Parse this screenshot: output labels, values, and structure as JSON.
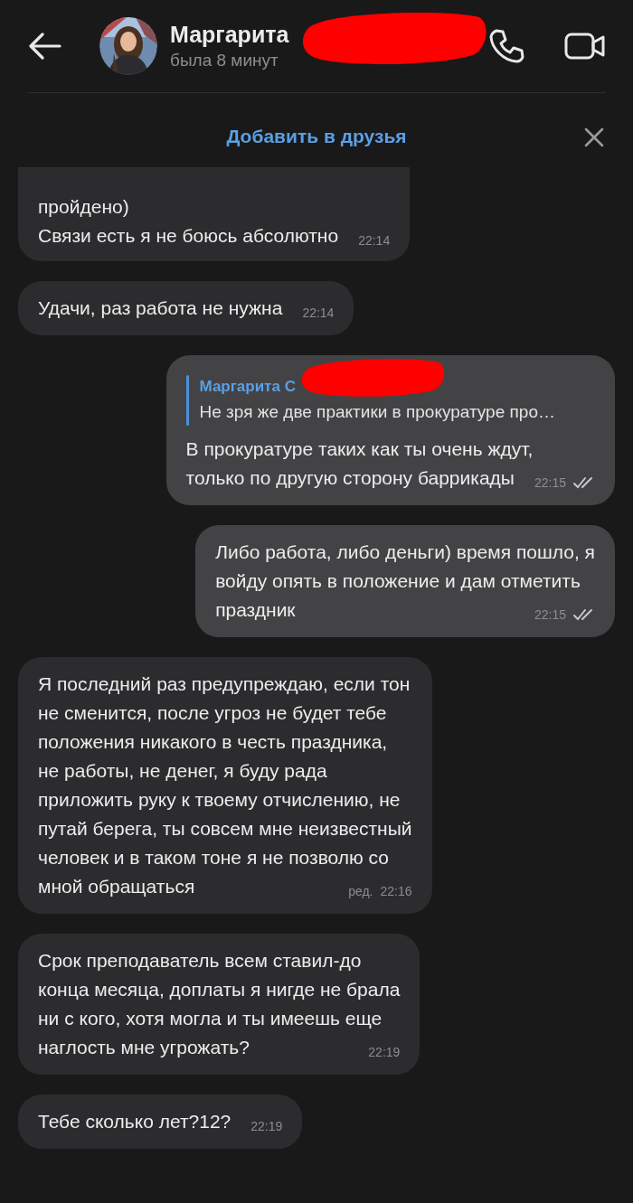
{
  "header": {
    "name": "Маргарита",
    "status": "была 8 минут",
    "redacted": true
  },
  "add_friend": {
    "label": "Добавить в друзья"
  },
  "messages": [
    {
      "kind": "in",
      "clipped": true,
      "text": "пройдено)\nСвязи есть я не боюсь абсолютно",
      "time": "22:14"
    },
    {
      "kind": "in",
      "clipped": false,
      "text": "Удачи, раз работа не нужна",
      "time": "22:14"
    },
    {
      "kind": "out",
      "clipped": false,
      "reply": {
        "name": "Маргарита С",
        "redacted": true,
        "text": "Не зря же две практики в прокуратуре про…"
      },
      "text": "В прокуратуре таких как ты очень ждут,\nтолько по другую сторону баррикады",
      "time": "22:15",
      "read": true
    },
    {
      "kind": "out",
      "clipped": false,
      "text": "Либо работа, либо деньги) время пошло, я\nвойду опять в положение и дам отметить\nпраздник",
      "time": "22:15",
      "read": true
    },
    {
      "kind": "in",
      "clipped": false,
      "text": "Я последний раз предупреждаю, если тон\nне сменится, после угроз не будет тебе\nположения никакого в честь праздника,\nне работы, не денег, я буду рада\nприложить руку к твоему отчислению, не\nпутай берега, ты совсем мне неизвестный\nчеловек и в таком тоне я не позволю со\nмной обращаться",
      "time": "22:16",
      "edited_label": "ред."
    },
    {
      "kind": "in",
      "clipped": false,
      "text": "Срок преподаватель всем ставил-до\nконца месяца, доплаты я нигде не брала\nни с кого, хотя могла и ты имеешь еще\nнаглость мне угрожать?",
      "time": "22:19"
    },
    {
      "kind": "in",
      "clipped": false,
      "text": "Тебе сколько лет?12?",
      "time": "22:19"
    }
  ]
}
